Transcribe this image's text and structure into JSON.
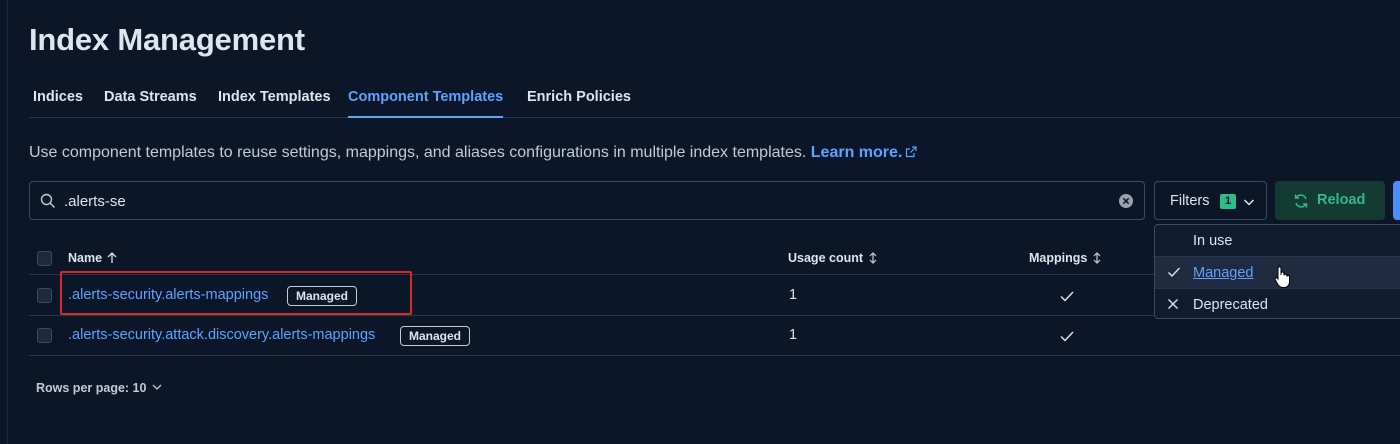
{
  "page": {
    "title": "Index Management"
  },
  "tabs": [
    {
      "label": "Indices",
      "active": false
    },
    {
      "label": "Data Streams",
      "active": false
    },
    {
      "label": "Index Templates",
      "active": false
    },
    {
      "label": "Component Templates",
      "active": true
    },
    {
      "label": "Enrich Policies",
      "active": false
    }
  ],
  "description": {
    "text": "Use component templates to reuse settings, mappings, and aliases configurations in multiple index templates.",
    "link_label": "Learn more."
  },
  "search": {
    "value": ".alerts-se"
  },
  "toolbar": {
    "filters_label": "Filters",
    "filters_count": "1",
    "reload_label": "Reload"
  },
  "table": {
    "columns": {
      "name": "Name",
      "usage_count": "Usage count",
      "mappings": "Mappings"
    },
    "rows": [
      {
        "name": ".alerts-security.alerts-mappings",
        "badge": "Managed",
        "usage_count": "1",
        "mappings": true
      },
      {
        "name": ".alerts-security.attack.discovery.alerts-mappings",
        "badge": "Managed",
        "usage_count": "1",
        "mappings": true
      }
    ]
  },
  "pagination": {
    "rows_per_page_label": "Rows per page: 10"
  },
  "filter_menu": {
    "items": [
      {
        "label": "In use",
        "state": "none"
      },
      {
        "label": "Managed",
        "state": "checked"
      },
      {
        "label": "Deprecated",
        "state": "excluded"
      }
    ]
  },
  "colors": {
    "background": "#0b1628",
    "accent": "#61a2ff",
    "success": "#2fba8a",
    "highlight": "#d52a2a"
  }
}
